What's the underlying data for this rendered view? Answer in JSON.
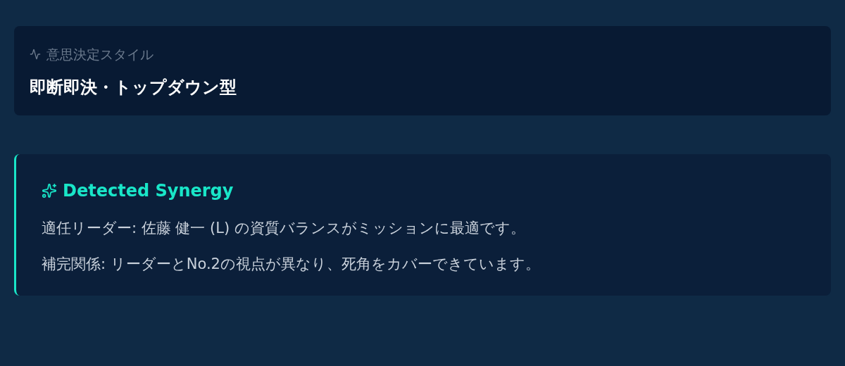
{
  "decision_style": {
    "label": "意思決定スタイル",
    "value": "即断即決・トップダウン型"
  },
  "synergy": {
    "title": "Detected Synergy",
    "lines": [
      "適任リーダー: 佐藤 健一 (L) の資質バランスがミッションに最適です。",
      "補完関係: リーダーとNo.2の視点が異なり、死角をカバーできています。"
    ]
  }
}
